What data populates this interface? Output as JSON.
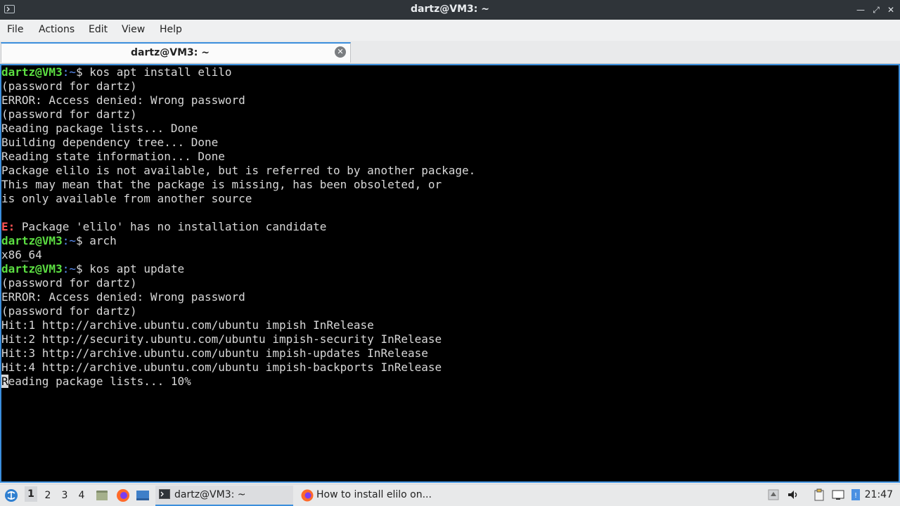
{
  "window": {
    "title": "dartz@VM3: ~"
  },
  "menubar": {
    "items": [
      "File",
      "Actions",
      "Edit",
      "View",
      "Help"
    ]
  },
  "tab": {
    "label": "dartz@VM3: ~"
  },
  "terminal": {
    "lines": [
      {
        "user": "dartz@VM3",
        "sep": ":",
        "path": "~",
        "cmd": "$ kos apt install elilo"
      },
      {
        "text": "(password for dartz)"
      },
      {
        "text": "ERROR: Access denied: Wrong password"
      },
      {
        "text": "(password for dartz)"
      },
      {
        "text": "Reading package lists... Done"
      },
      {
        "text": "Building dependency tree... Done"
      },
      {
        "text": "Reading state information... Done"
      },
      {
        "text": "Package elilo is not available, but is referred to by another package."
      },
      {
        "text": "This may mean that the package is missing, has been obsoleted, or"
      },
      {
        "text": "is only available from another source"
      },
      {
        "text": ""
      },
      {
        "err": "E:",
        "text": " Package 'elilo' has no installation candidate"
      },
      {
        "user": "dartz@VM3",
        "sep": ":",
        "path": "~",
        "cmd": "$ arch"
      },
      {
        "text": "x86_64"
      },
      {
        "user": "dartz@VM3",
        "sep": ":",
        "path": "~",
        "cmd": "$ kos apt update"
      },
      {
        "text": "(password for dartz)"
      },
      {
        "text": "ERROR: Access denied: Wrong password"
      },
      {
        "text": "(password for dartz)"
      },
      {
        "text": "Hit:1 http://archive.ubuntu.com/ubuntu impish InRelease"
      },
      {
        "text": "Hit:2 http://security.ubuntu.com/ubuntu impish-security InRelease"
      },
      {
        "text": "Hit:3 http://archive.ubuntu.com/ubuntu impish-updates InRelease"
      },
      {
        "text": "Hit:4 http://archive.ubuntu.com/ubuntu impish-backports InRelease"
      },
      {
        "cursor": "R",
        "text": "eading package lists... 10%"
      }
    ]
  },
  "taskbar": {
    "workspaces": [
      "1",
      "2",
      "3",
      "4"
    ],
    "active_workspace": "1",
    "tasks": [
      {
        "label": "dartz@VM3: ~",
        "icon": "terminal-icon",
        "active": true
      },
      {
        "label": "How to install elilo on...",
        "icon": "firefox-icon",
        "active": false
      }
    ],
    "clock": "21:47"
  },
  "colors": {
    "accent": "#3b8edc",
    "prompt_user": "#5cdf42",
    "prompt_path": "#5b8ff6",
    "error": "#ff5555"
  }
}
